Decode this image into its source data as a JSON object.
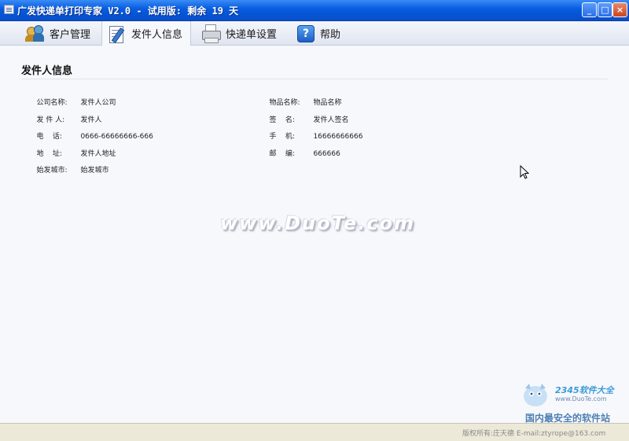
{
  "window": {
    "title": "广发快递单打印专家 V2.0 - 试用版: 剩余 19 天",
    "min_glyph": "_",
    "max_glyph": "□",
    "close_glyph": "×"
  },
  "tabs": [
    {
      "label": "客户管理",
      "icon": "customers-icon",
      "active": false
    },
    {
      "label": "发件人信息",
      "icon": "sender-info-icon",
      "active": true
    },
    {
      "label": "快递单设置",
      "icon": "printer-icon",
      "active": false
    },
    {
      "label": "帮助",
      "icon": "help-icon",
      "active": false
    }
  ],
  "section": {
    "title": "发件人信息"
  },
  "fields": {
    "company": {
      "label": "公司名称:",
      "value": "发件人公司"
    },
    "sender": {
      "label": "发 件 人:",
      "value": "发件人"
    },
    "phone": {
      "label": "电    话:",
      "value": "0666-66666666-666"
    },
    "address": {
      "label": "地    址:",
      "value": "发件人地址"
    },
    "origin_city": {
      "label": "始发城市:",
      "value": "始发城市"
    },
    "item_name": {
      "label": "物品名称:",
      "value": "物品名称"
    },
    "signature": {
      "label": "签    名:",
      "value": "发件人签名"
    },
    "mobile": {
      "label": "手    机:",
      "value": "16666666666"
    },
    "postcode": {
      "label": "邮    编:",
      "value": "666666"
    }
  },
  "watermark": "www.DuoTe.com",
  "branding": {
    "logo_text": "2345软件大全",
    "site": "www.DuoTe.com",
    "slogan": "国内最安全的软件站"
  },
  "status": {
    "text": "版权所有:庄天德  E-mail:ztyrope@163.com"
  },
  "colors": {
    "titlebar": "#0554d6",
    "content_bg": "#f7f8fc",
    "statusbar": "#ece9d8"
  }
}
